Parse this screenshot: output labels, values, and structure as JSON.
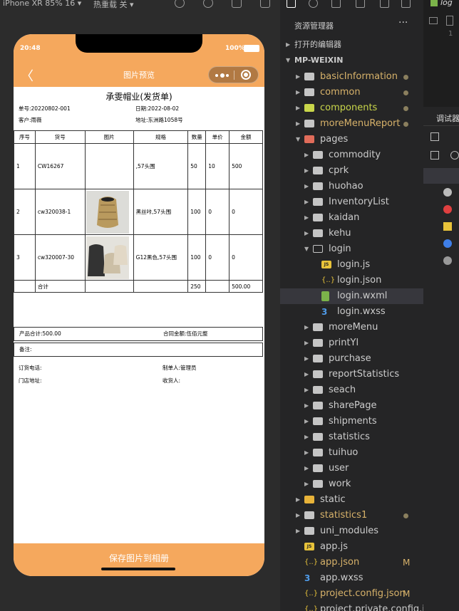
{
  "toolbar": {
    "device": "iPhone XR 85% 16 ▾",
    "reload": "热重载 关 ▾"
  },
  "phone": {
    "time": "20:48",
    "battery": "100%",
    "nav_title": "图片预览",
    "back": "〈",
    "save_button": "保存图片到相册"
  },
  "doc": {
    "title": "承雯帽业(发货单)",
    "order_no": "单号:20220802-001",
    "date": "日期:2022-08-02",
    "customer": "客户:雨薇",
    "address": "地址:东洲路1058号",
    "headers": [
      "序号",
      "货号",
      "图片",
      "规格",
      "数量",
      "单价",
      "金额"
    ],
    "rows": [
      {
        "no": "1",
        "code": "CW16267",
        "spec": ",57头围",
        "qty": "50",
        "price": "10",
        "amount": "500"
      },
      {
        "no": "2",
        "code": "cw320038-1",
        "spec": "黑丝咔,57头围",
        "qty": "100",
        "price": "0",
        "amount": "0"
      },
      {
        "no": "3",
        "code": "cw320007-30",
        "spec": "G12黑色,57头围",
        "qty": "100",
        "price": "0",
        "amount": "0"
      }
    ],
    "total_label": "合计",
    "total_qty": "250",
    "total_amount": "500.00",
    "product_total": "产品合计:500.00",
    "contract_amount": "合同金额:伍佰元整",
    "remark": "备注:",
    "order_phone": "订货电话:",
    "maker": "制单人:管理员",
    "store_address": "门店地址:",
    "receiver": "收货人:"
  },
  "explorer": {
    "title": "资源管理器",
    "more": "···",
    "open_editors": "打开的编辑器",
    "project": "MP-WEIXIN",
    "items": [
      {
        "label": "basicInformation",
        "color": "#d7b26a"
      },
      {
        "label": "common",
        "color": "#d7b26a"
      },
      {
        "label": "components",
        "color": "#c9d64a"
      },
      {
        "label": "moreMenuReport",
        "color": "#d7b26a"
      },
      {
        "label": "pages"
      },
      {
        "label": "commodity"
      },
      {
        "label": "cprk"
      },
      {
        "label": "huohao"
      },
      {
        "label": "InventoryList"
      },
      {
        "label": "kaidan"
      },
      {
        "label": "kehu"
      },
      {
        "label": "login"
      },
      {
        "label": "login.js"
      },
      {
        "label": "login.json"
      },
      {
        "label": "login.wxml"
      },
      {
        "label": "login.wxss"
      },
      {
        "label": "moreMenu"
      },
      {
        "label": "printYl"
      },
      {
        "label": "purchase"
      },
      {
        "label": "reportStatistics"
      },
      {
        "label": "seach"
      },
      {
        "label": "sharePage"
      },
      {
        "label": "shipments"
      },
      {
        "label": "statistics"
      },
      {
        "label": "tuihuo"
      },
      {
        "label": "user"
      },
      {
        "label": "work"
      },
      {
        "label": "static"
      },
      {
        "label": "statistics1",
        "color": "#d7b26a"
      },
      {
        "label": "uni_modules"
      },
      {
        "label": "app.js"
      },
      {
        "label": "app.json",
        "color": "#d7b26a"
      },
      {
        "label": "app.wxss"
      },
      {
        "label": "project.config.json",
        "color": "#d7b26a"
      },
      {
        "label": "project.private.config.js"
      }
    ],
    "modified": "M"
  },
  "right": {
    "tab": "log",
    "line": "1",
    "panel_title": "调试器"
  }
}
